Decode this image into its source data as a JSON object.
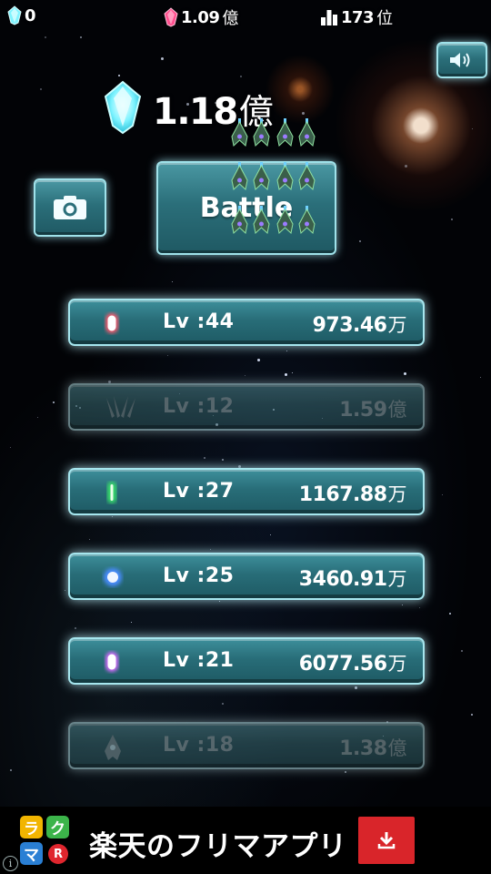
{
  "topbar": {
    "crystals": "0",
    "gems": {
      "value": "1.09",
      "unit": "億"
    },
    "rank": {
      "value": "173",
      "unit": "位"
    }
  },
  "icons": {
    "crystal": "crystal-icon",
    "gem": "pink-gem-icon",
    "rank": "bar-chart-icon",
    "sound": "speaker-icon",
    "camera": "camera-icon",
    "download": "download-icon"
  },
  "total": {
    "value": "1.18",
    "unit": "億"
  },
  "battle_label": "Battle",
  "slots": [
    {
      "level": "Lv :44",
      "amount": "973.46",
      "unit": "万",
      "color": "#ff5a6e",
      "shape": "capsule",
      "locked": false
    },
    {
      "level": "Lv :12",
      "amount": "1.59",
      "unit": "億",
      "color": "#7aa0a8",
      "shape": "wings",
      "locked": true
    },
    {
      "level": "Lv :27",
      "amount": "1167.88",
      "unit": "万",
      "color": "#39e06a",
      "shape": "bar",
      "locked": false
    },
    {
      "level": "Lv :25",
      "amount": "3460.91",
      "unit": "万",
      "color": "#4a8cff",
      "shape": "orb",
      "locked": false
    },
    {
      "level": "Lv :21",
      "amount": "6077.56",
      "unit": "万",
      "color": "#d86bff",
      "shape": "capsule",
      "locked": false
    },
    {
      "level": "Lv :18",
      "amount": "1.38",
      "unit": "億",
      "color": "#7aa0a8",
      "shape": "ship",
      "locked": true
    }
  ],
  "ad": {
    "logo_letters": [
      "ラ",
      "ク",
      "マ",
      "R"
    ],
    "logo_colors": [
      "#f2b500",
      "#3cb44a",
      "#2a7fd4",
      "#e0262e"
    ],
    "headline": "楽天のフリマアプリ",
    "info": "i"
  }
}
